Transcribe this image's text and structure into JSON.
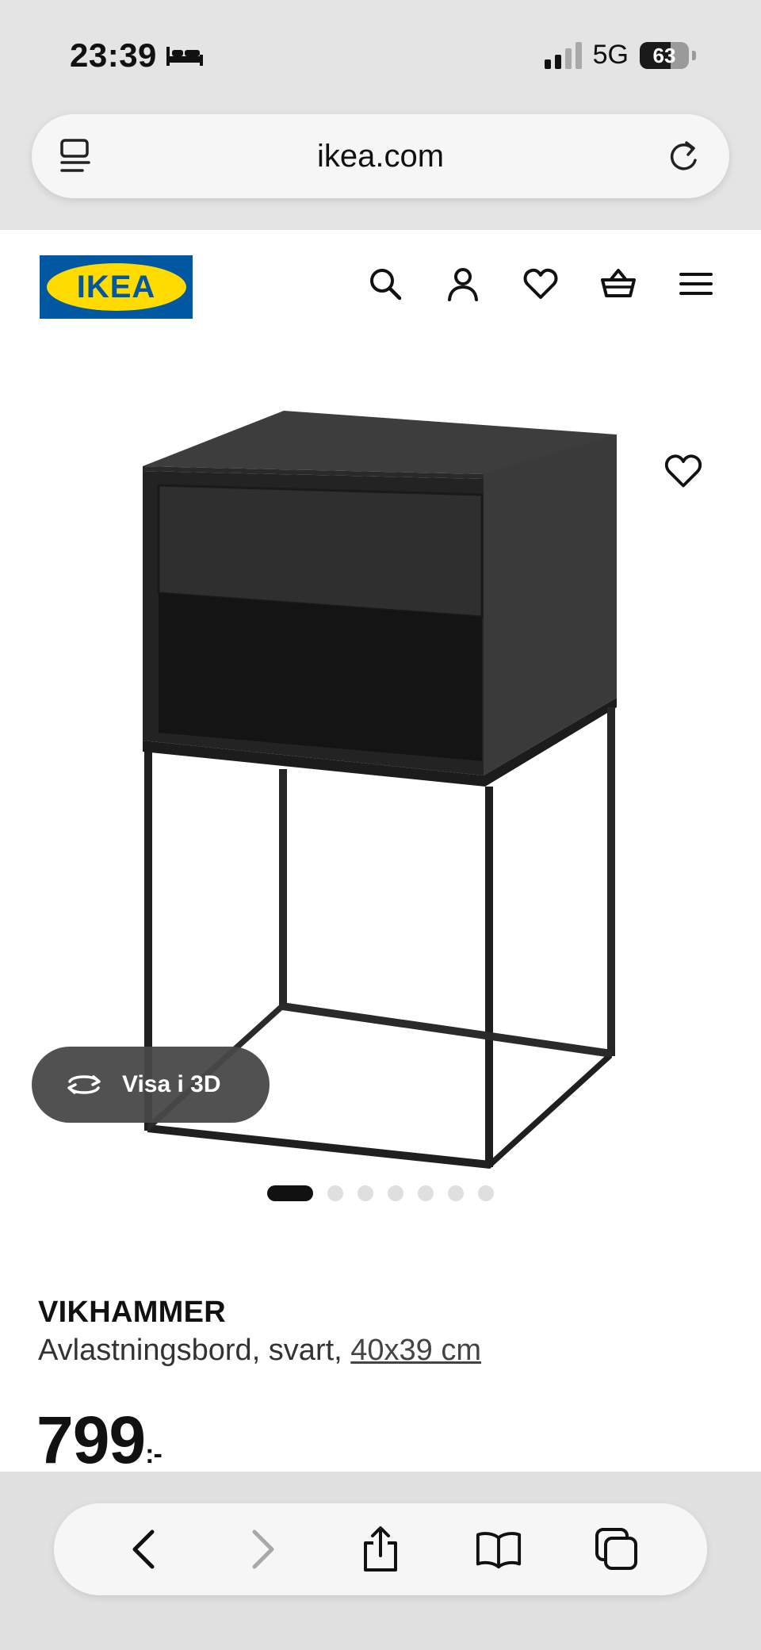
{
  "status_bar": {
    "time": "23:39",
    "network": "5G",
    "battery_percent": "63",
    "battery_level": 0.63,
    "sleep_icon": "bed-icon"
  },
  "browser": {
    "url": "ikea.com",
    "left_icon": "reader-icon",
    "right_icon": "reload-icon"
  },
  "header": {
    "logo_text": "IKEA",
    "icons": [
      "search-icon",
      "account-icon",
      "heart-icon",
      "basket-icon",
      "menu-icon"
    ]
  },
  "gallery": {
    "view_3d_label": "Visa i 3D",
    "total_images": 7,
    "active_index": 0
  },
  "product": {
    "name": "VIKHAMMER",
    "description": "Avlastningsbord, svart, ",
    "size": "40x39 cm",
    "price": "799",
    "price_suffix": ":-"
  },
  "bottom_bar": {
    "icons": [
      "back-icon",
      "forward-icon",
      "share-icon",
      "bookmarks-icon",
      "tabs-icon"
    ]
  },
  "colors": {
    "ikea_blue": "#0058a3",
    "ikea_yellow": "#ffdb00",
    "chrome_gray": "#e4e4e4"
  }
}
